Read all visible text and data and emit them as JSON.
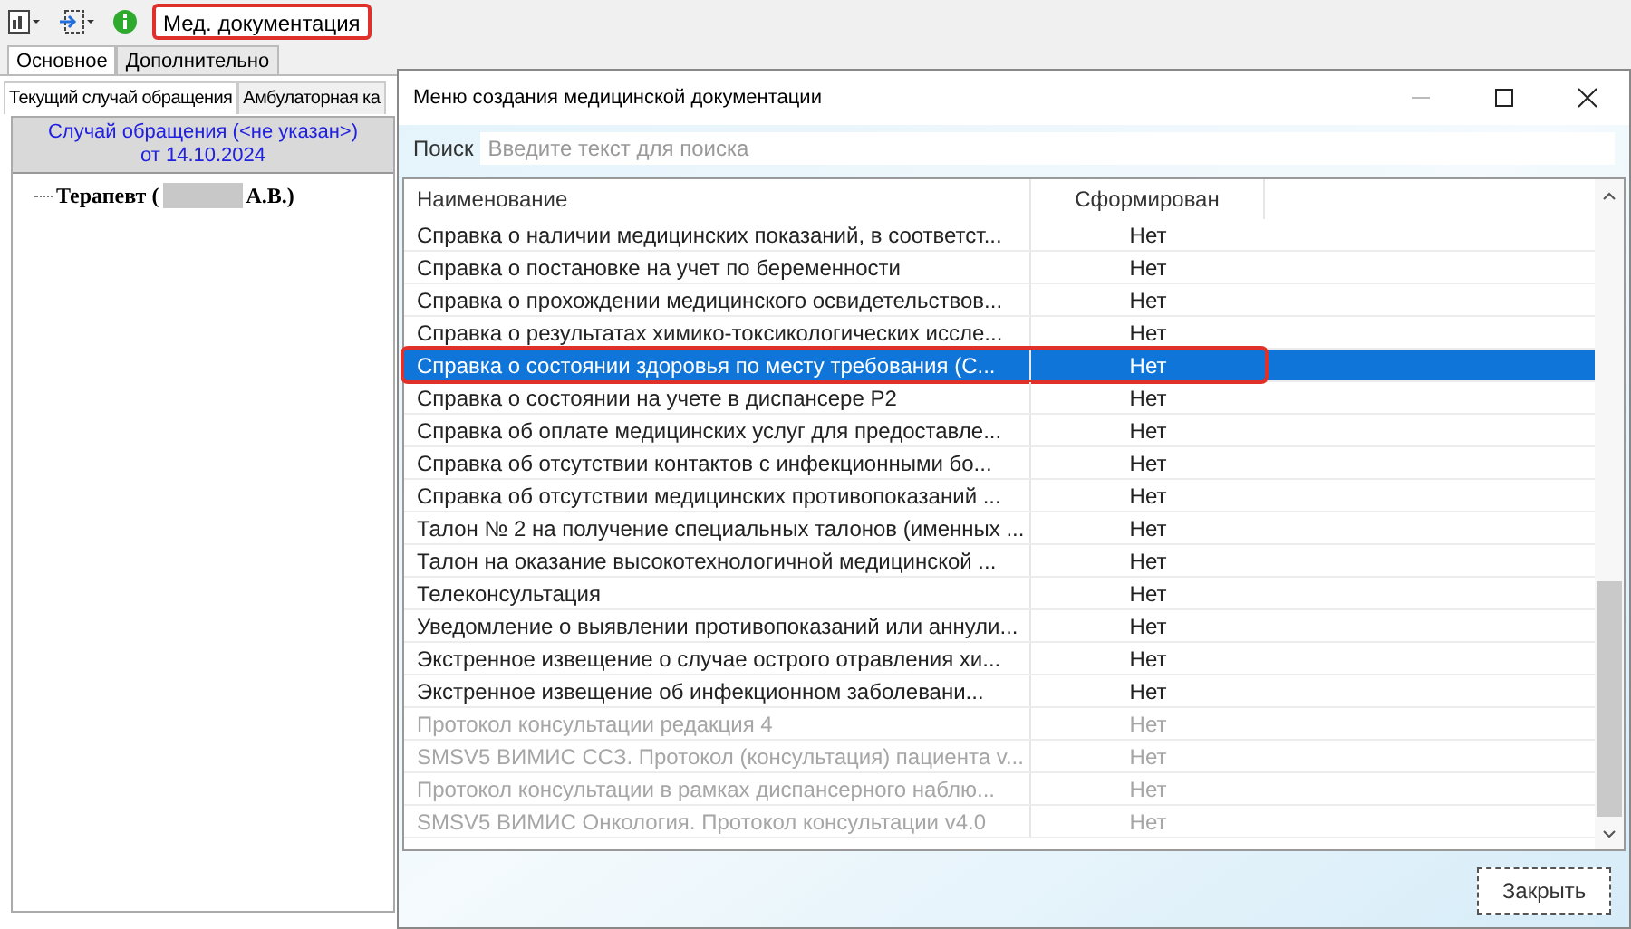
{
  "toolbar": {
    "doc_button": {
      "label": "Мед. документация",
      "highlighted": true
    }
  },
  "main_tabs": [
    {
      "label": "Основное",
      "selected": true
    },
    {
      "label": "Дополнительно",
      "selected": false
    }
  ],
  "sub_tabs": [
    {
      "label": "Текущий случай обращения",
      "selected": true
    },
    {
      "label": "Амбулаторная ка",
      "selected": false
    }
  ],
  "case_header": {
    "line1": "Случай обращения (<не указан>)",
    "line2": "от 14.10.2024"
  },
  "tree": [
    {
      "prefix": "Терапевт (",
      "redacted": true,
      "suffix": "А.В.)"
    }
  ],
  "dialog": {
    "title": "Меню создания медицинской документации",
    "search": {
      "label": "Поиск",
      "placeholder": "Введите текст для поиска"
    },
    "table": {
      "columns": [
        "Наименование",
        "Сформирован"
      ],
      "rows": [
        {
          "name": "Справка о наличии медицинских показаний, в соответст...",
          "status": "Нет",
          "selected": false,
          "disabled": false,
          "highlighted": false
        },
        {
          "name": "Справка о постановке на учет по беременности",
          "status": "Нет",
          "selected": false,
          "disabled": false,
          "highlighted": false
        },
        {
          "name": "Справка о прохождении медицинского освидетельствов...",
          "status": "Нет",
          "selected": false,
          "disabled": false,
          "highlighted": false
        },
        {
          "name": "Справка о результатах химико-токсикологических иссле...",
          "status": "Нет",
          "selected": false,
          "disabled": false,
          "highlighted": false
        },
        {
          "name": "Справка о состоянии здоровья по месту требования (С...",
          "status": "Нет",
          "selected": true,
          "disabled": false,
          "highlighted": true
        },
        {
          "name": "Справка о состоянии на учете в диспансере Р2",
          "status": "Нет",
          "selected": false,
          "disabled": false,
          "highlighted": false
        },
        {
          "name": "Справка об оплате медицинских услуг для предоставле...",
          "status": "Нет",
          "selected": false,
          "disabled": false,
          "highlighted": false
        },
        {
          "name": "Справка об отсутствии контактов с инфекционными бо...",
          "status": "Нет",
          "selected": false,
          "disabled": false,
          "highlighted": false
        },
        {
          "name": "Справка об отсутствии медицинских противопоказаний ...",
          "status": "Нет",
          "selected": false,
          "disabled": false,
          "highlighted": false
        },
        {
          "name": "Талон № 2 на получение специальных талонов (именных ...",
          "status": "Нет",
          "selected": false,
          "disabled": false,
          "highlighted": false
        },
        {
          "name": "Талон на оказание высокотехнологичной медицинской ...",
          "status": "Нет",
          "selected": false,
          "disabled": false,
          "highlighted": false
        },
        {
          "name": "Телеконсультация",
          "status": "Нет",
          "selected": false,
          "disabled": false,
          "highlighted": false
        },
        {
          "name": "Уведомление о выявлении противопоказаний или аннули...",
          "status": "Нет",
          "selected": false,
          "disabled": false,
          "highlighted": false
        },
        {
          "name": "Экстренное извещение о случае острого отравления хи...",
          "status": "Нет",
          "selected": false,
          "disabled": false,
          "highlighted": false
        },
        {
          "name": "Экстренное извещение об инфекционном заболевани...",
          "status": "Нет",
          "selected": false,
          "disabled": false,
          "highlighted": false
        },
        {
          "name": "Протокол консультации редакция 4",
          "status": "Нет",
          "selected": false,
          "disabled": true,
          "highlighted": false
        },
        {
          "name": "SMSV5 ВИМИС ССЗ. Протокол (консультация) пациента v...",
          "status": "Нет",
          "selected": false,
          "disabled": true,
          "highlighted": false
        },
        {
          "name": "Протокол консультации в рамках диспансерного наблю...",
          "status": "Нет",
          "selected": false,
          "disabled": true,
          "highlighted": false
        },
        {
          "name": "SMSV5 ВИМИС Онкология. Протокол консультации v4.0",
          "status": "Нет",
          "selected": false,
          "disabled": true,
          "highlighted": false
        }
      ]
    },
    "close_button": "Закрыть"
  }
}
